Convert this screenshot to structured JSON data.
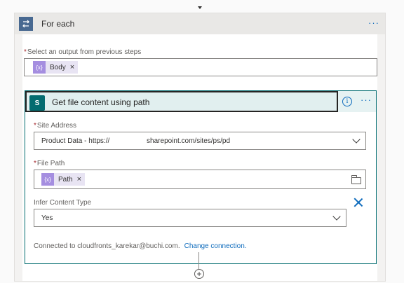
{
  "foreach": {
    "title": "For each",
    "more": "···",
    "select_label": "Select an output from previous steps",
    "required_marker": "*",
    "token": {
      "icon": "{x}",
      "label": "Body",
      "remove": "×"
    }
  },
  "action": {
    "title": "Get file content using path",
    "app_icon_text": "S",
    "info": "i",
    "more": "···",
    "site_address": {
      "label": "Site Address",
      "value": "Product Data - https://                   sharepoint.com/sites/ps/pd"
    },
    "file_path": {
      "label": "File Path",
      "token": {
        "icon": "{x}",
        "label": "Path",
        "remove": "×"
      }
    },
    "infer_content_type": {
      "label": "Infer Content Type",
      "value": "Yes"
    },
    "footer": {
      "connected_text": "Connected to cloudfronts_karekar@buchi.com.",
      "change_link": "Change connection."
    }
  },
  "add_step": "+"
}
